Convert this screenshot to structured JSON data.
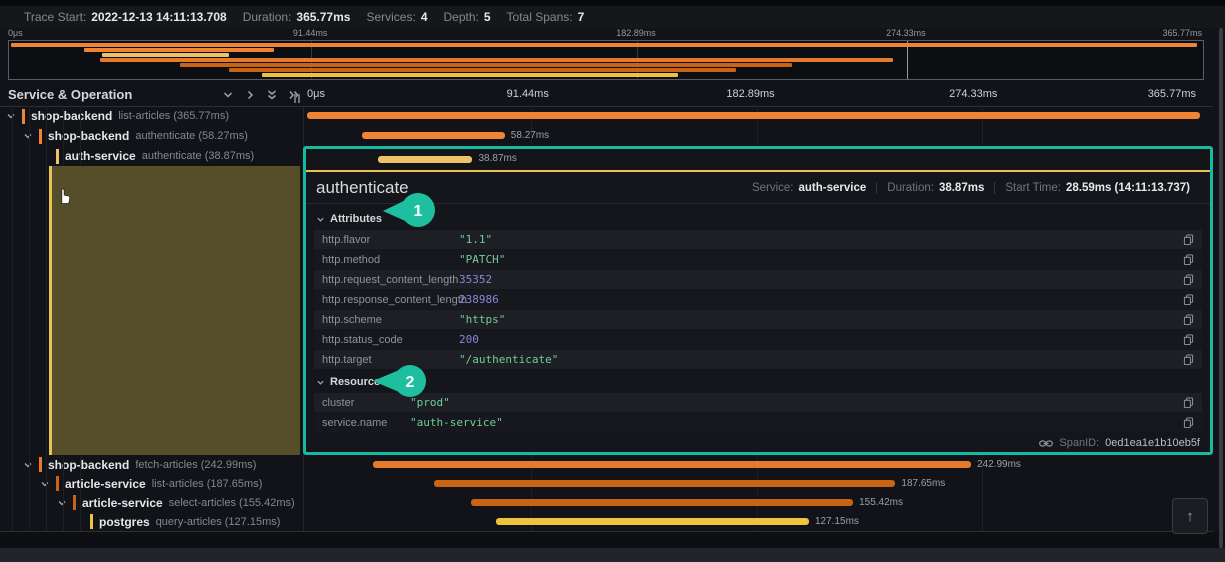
{
  "header": {
    "items": [
      {
        "label": "Trace Start:",
        "value": "2022-12-13 14:11:13.708"
      },
      {
        "label": "Duration:",
        "value": "365.77ms"
      },
      {
        "label": "Services:",
        "value": "4"
      },
      {
        "label": "Depth:",
        "value": "5"
      },
      {
        "label": "Total Spans:",
        "value": "7"
      }
    ]
  },
  "minimap": {
    "ticks": [
      "0μs",
      "91.44ms",
      "182.89ms",
      "274.33ms",
      "365.77ms"
    ]
  },
  "timeline": {
    "ticks": [
      "0μs",
      "91.44ms",
      "182.89ms",
      "274.33ms",
      "365.77ms"
    ]
  },
  "tree_header": {
    "title": "Service & Operation"
  },
  "spans": [
    {
      "service": "shop-backend",
      "operation": "list-articles (365.77ms)",
      "depth": 0,
      "has_children": true,
      "color": "#ee8434",
      "start_pct": 0.2,
      "width_pct": 99.3,
      "duration_label": ""
    },
    {
      "service": "shop-backend",
      "operation": "authenticate (58.27ms)",
      "depth": 1,
      "has_children": true,
      "color": "#ee8434",
      "start_pct": 6.3,
      "width_pct": 15.9,
      "duration_label": "58.27ms"
    },
    {
      "service": "auth-service",
      "operation": "authenticate (38.87ms)",
      "depth": 2,
      "has_children": false,
      "color": "#ecc368",
      "start_pct": 7.8,
      "width_pct": 10.6,
      "duration_label": "38.87ms"
    },
    {
      "service": "shop-backend",
      "operation": "fetch-articles (242.99ms)",
      "depth": 1,
      "has_children": true,
      "color": "#e57a2c",
      "start_pct": 7.6,
      "width_pct": 66.4,
      "duration_label": "242.99ms"
    },
    {
      "service": "article-service",
      "operation": "list-articles (187.65ms)",
      "depth": 2,
      "has_children": true,
      "color": "#c96414",
      "start_pct": 14.3,
      "width_pct": 51.3,
      "duration_label": "187.65ms"
    },
    {
      "service": "article-service",
      "operation": "select-articles (155.42ms)",
      "depth": 3,
      "has_children": true,
      "color": "#c96414",
      "start_pct": 18.4,
      "width_pct": 42.5,
      "duration_label": "155.42ms"
    },
    {
      "service": "postgres",
      "operation": "query-articles (127.15ms)",
      "depth": 4,
      "has_children": false,
      "color": "#eec33f",
      "start_pct": 21.2,
      "width_pct": 34.8,
      "duration_label": "127.15ms"
    }
  ],
  "detail": {
    "title": "authenticate",
    "meta": [
      {
        "label": "Service:",
        "value": "auth-service"
      },
      {
        "label": "Duration:",
        "value": "38.87ms"
      },
      {
        "label": "Start Time:",
        "value": "28.59ms (14:11:13.737)"
      }
    ],
    "sections": [
      {
        "name": "Attributes",
        "key_col": 137,
        "rows": [
          {
            "key": "http.flavor",
            "value": "\"1.1\"",
            "type": "string"
          },
          {
            "key": "http.method",
            "value": "\"PATCH\"",
            "type": "string"
          },
          {
            "key": "http.request_content_length",
            "value": "35352",
            "type": "number"
          },
          {
            "key": "http.response_content_length",
            "value": "238986",
            "type": "number"
          },
          {
            "key": "http.scheme",
            "value": "\"https\"",
            "type": "string"
          },
          {
            "key": "http.status_code",
            "value": "200",
            "type": "number"
          },
          {
            "key": "http.target",
            "value": "\"/authenticate\"",
            "type": "string"
          }
        ]
      },
      {
        "name": "Resource",
        "key_col": 88,
        "rows": [
          {
            "key": "cluster",
            "value": "\"prod\"",
            "type": "string"
          },
          {
            "key": "service.name",
            "value": "\"auth-service\"",
            "type": "string"
          }
        ]
      }
    ],
    "footer": {
      "label": "SpanID:",
      "value": "0ed1ea1e1b10eb5f"
    }
  },
  "callouts": [
    "1",
    "2"
  ],
  "scroll_top_label": "↑",
  "colors": {
    "accent_teal": "#14bba0",
    "selection_olive": "#554e29",
    "selected_span_yellow": "#e8c352",
    "string_value": "#6fce93",
    "number_value": "#8b85d6"
  }
}
